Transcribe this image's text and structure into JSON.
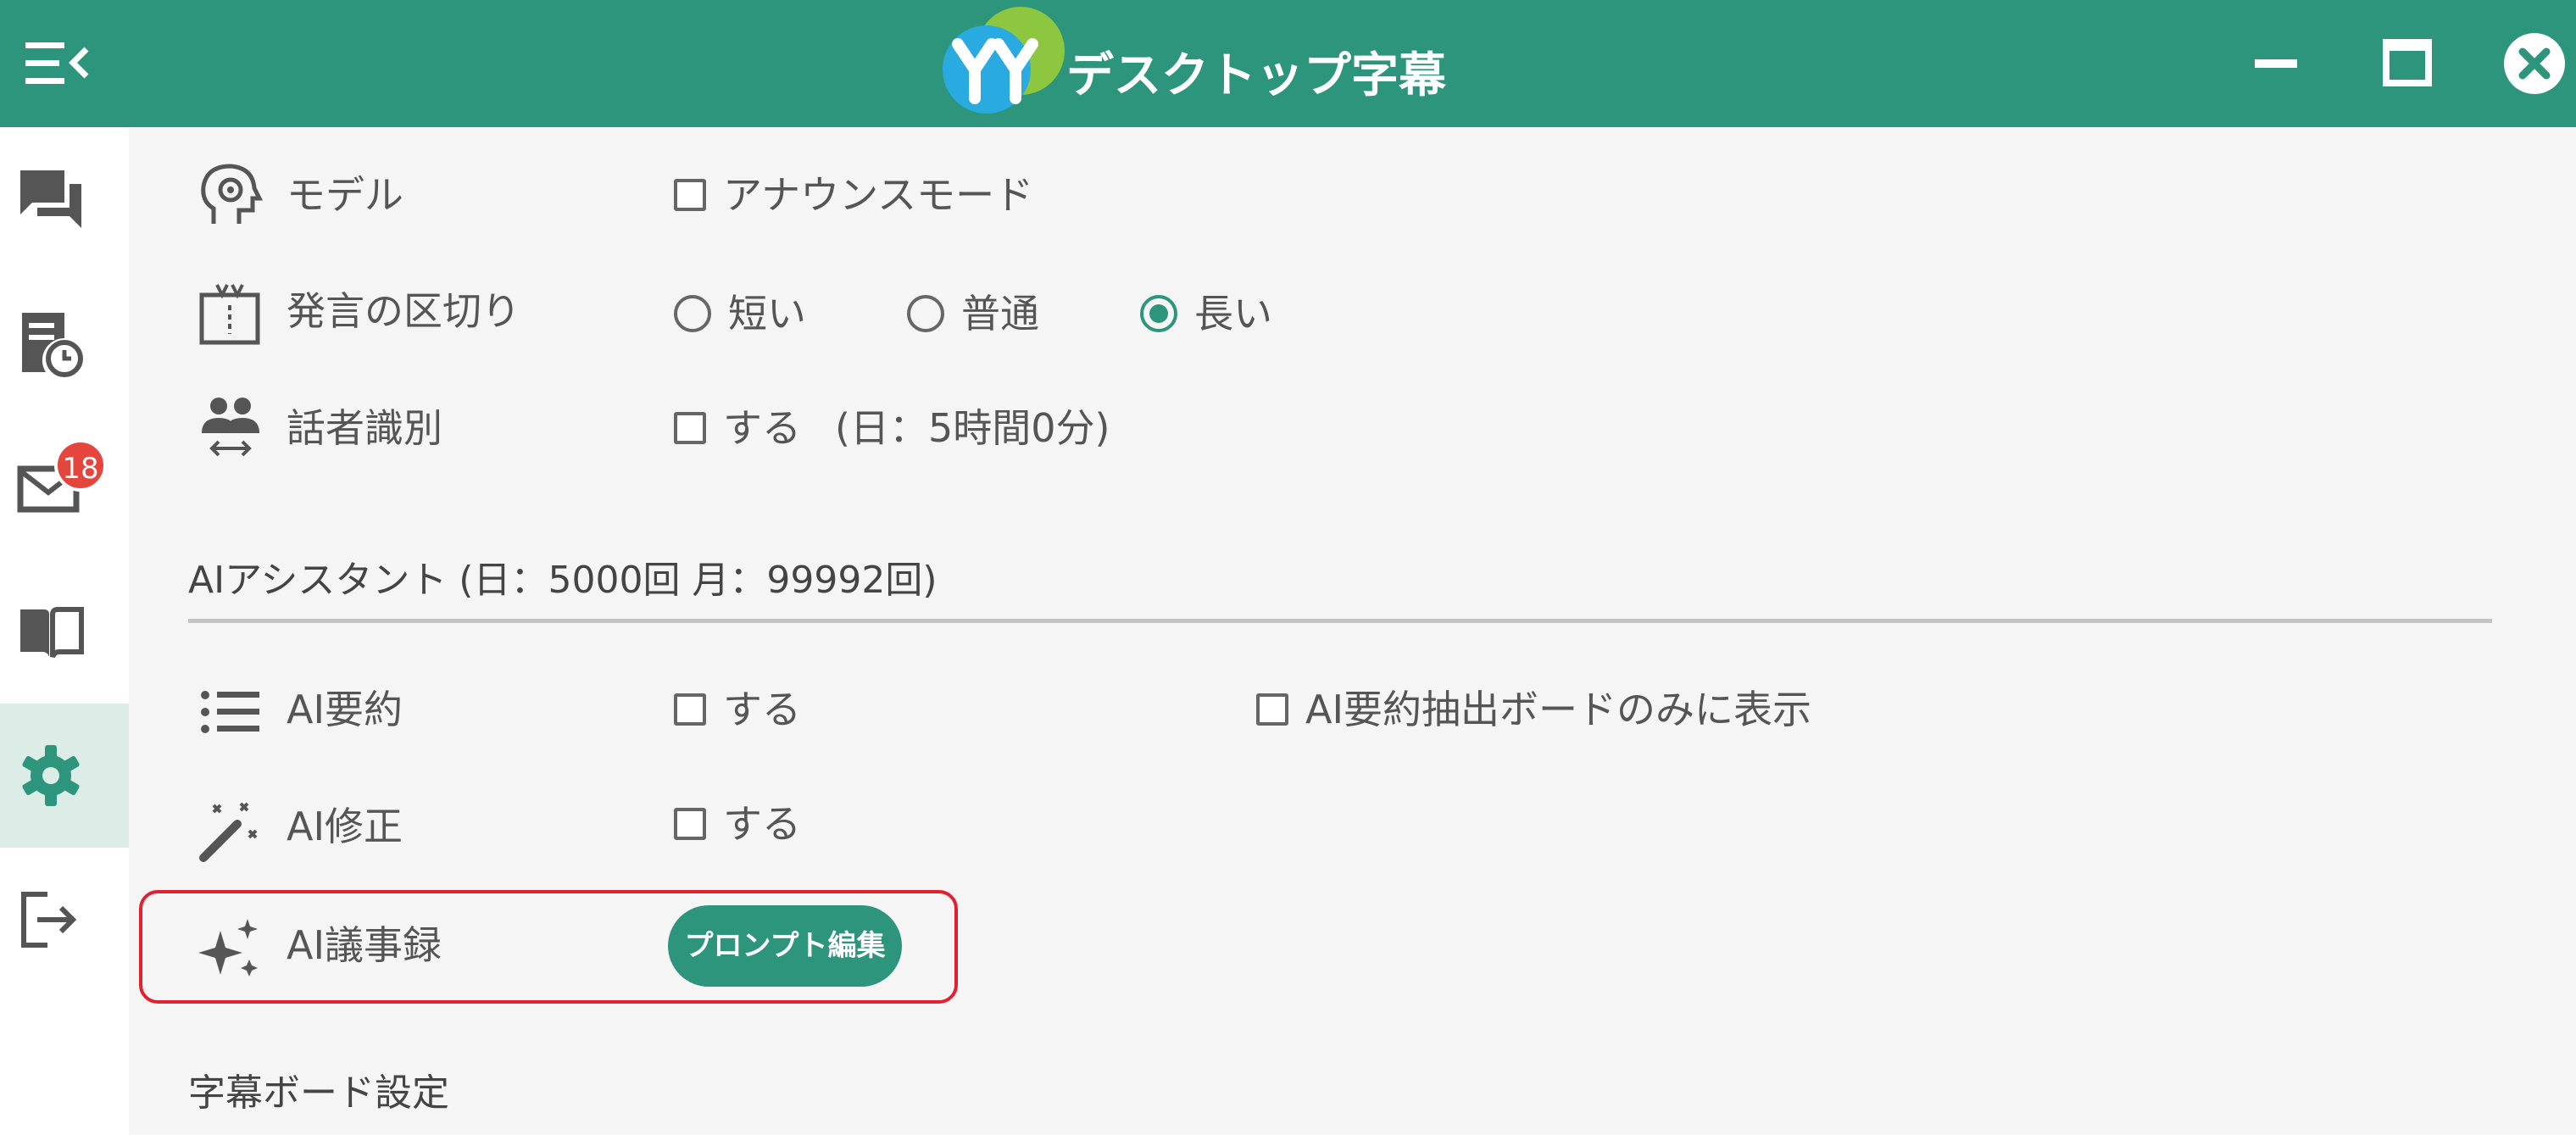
{
  "titlebar": {
    "app_title": "デスクトップ字幕",
    "brand_color": "#2d957c",
    "icons": [
      "menu-collapse-icon",
      "app-logo",
      "minimize-icon",
      "maximize-icon",
      "close-icon"
    ]
  },
  "sidebar": {
    "items": [
      {
        "name": "chat-icon"
      },
      {
        "name": "history-icon"
      },
      {
        "name": "mail-icon",
        "badge": "18"
      },
      {
        "name": "book-icon"
      },
      {
        "name": "settings-icon",
        "active": true
      },
      {
        "name": "logout-icon"
      }
    ]
  },
  "settings": {
    "model": {
      "label": "モデル",
      "option_announce": "アナウンスモード"
    },
    "segment": {
      "label": "発言の区切り",
      "options": [
        "短い",
        "普通",
        "長い"
      ],
      "selected": "長い"
    },
    "speaker": {
      "label": "話者識別",
      "option": "する",
      "quota": "(日：5時間0分)"
    },
    "ai_section": {
      "title": "AIアシスタント (日：5000回 月：99992回)"
    },
    "ai_summary": {
      "label": "AI要約",
      "option": "する",
      "option_board_only": "AI要約抽出ボードのみに表示"
    },
    "ai_fix": {
      "label": "AI修正",
      "option": "する"
    },
    "ai_minutes": {
      "label": "AI議事録",
      "button": "プロンプト編集"
    },
    "board_section": {
      "title": "字幕ボード設定"
    }
  }
}
